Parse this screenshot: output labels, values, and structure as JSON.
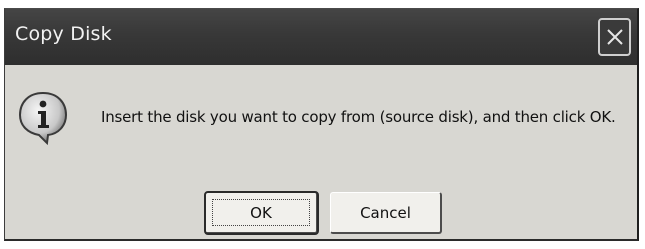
{
  "window": {
    "title": "Copy Disk"
  },
  "icons": {
    "info": "info-icon",
    "close": "close-icon"
  },
  "message": "Insert the disk you want to copy from (source disk), and then click OK.",
  "buttons": {
    "ok": "OK",
    "cancel": "Cancel"
  }
}
